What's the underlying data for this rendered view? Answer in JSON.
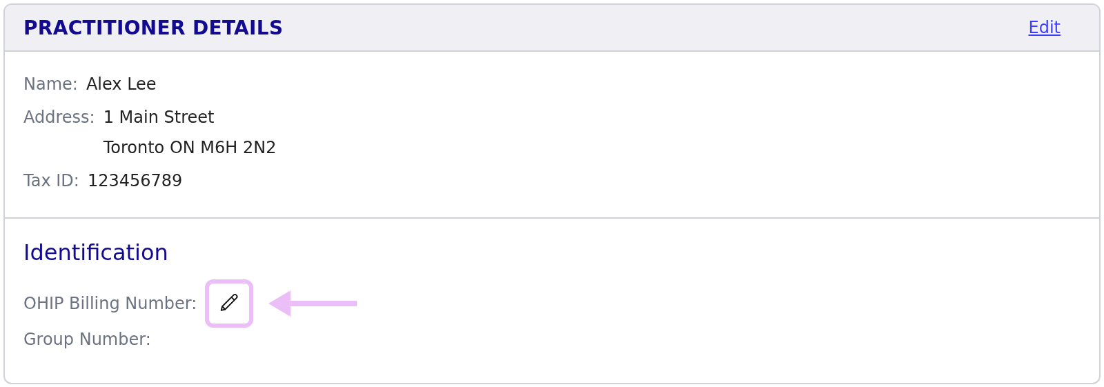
{
  "card": {
    "title": "PRACTITIONER DETAILS",
    "edit_link": "Edit"
  },
  "details": [
    {
      "label": "Name:",
      "lines": [
        "Alex Lee"
      ]
    },
    {
      "label": "Address:",
      "lines": [
        "1 Main Street",
        "Toronto ON M6H 2N2"
      ]
    },
    {
      "label": "Tax ID:",
      "lines": [
        "123456789"
      ]
    }
  ],
  "identification": {
    "title": "Identification",
    "fields": [
      {
        "label": "OHIP Billing Number:",
        "kind": "editable"
      },
      {
        "label": "Group Number:",
        "kind": "plain"
      }
    ]
  }
}
